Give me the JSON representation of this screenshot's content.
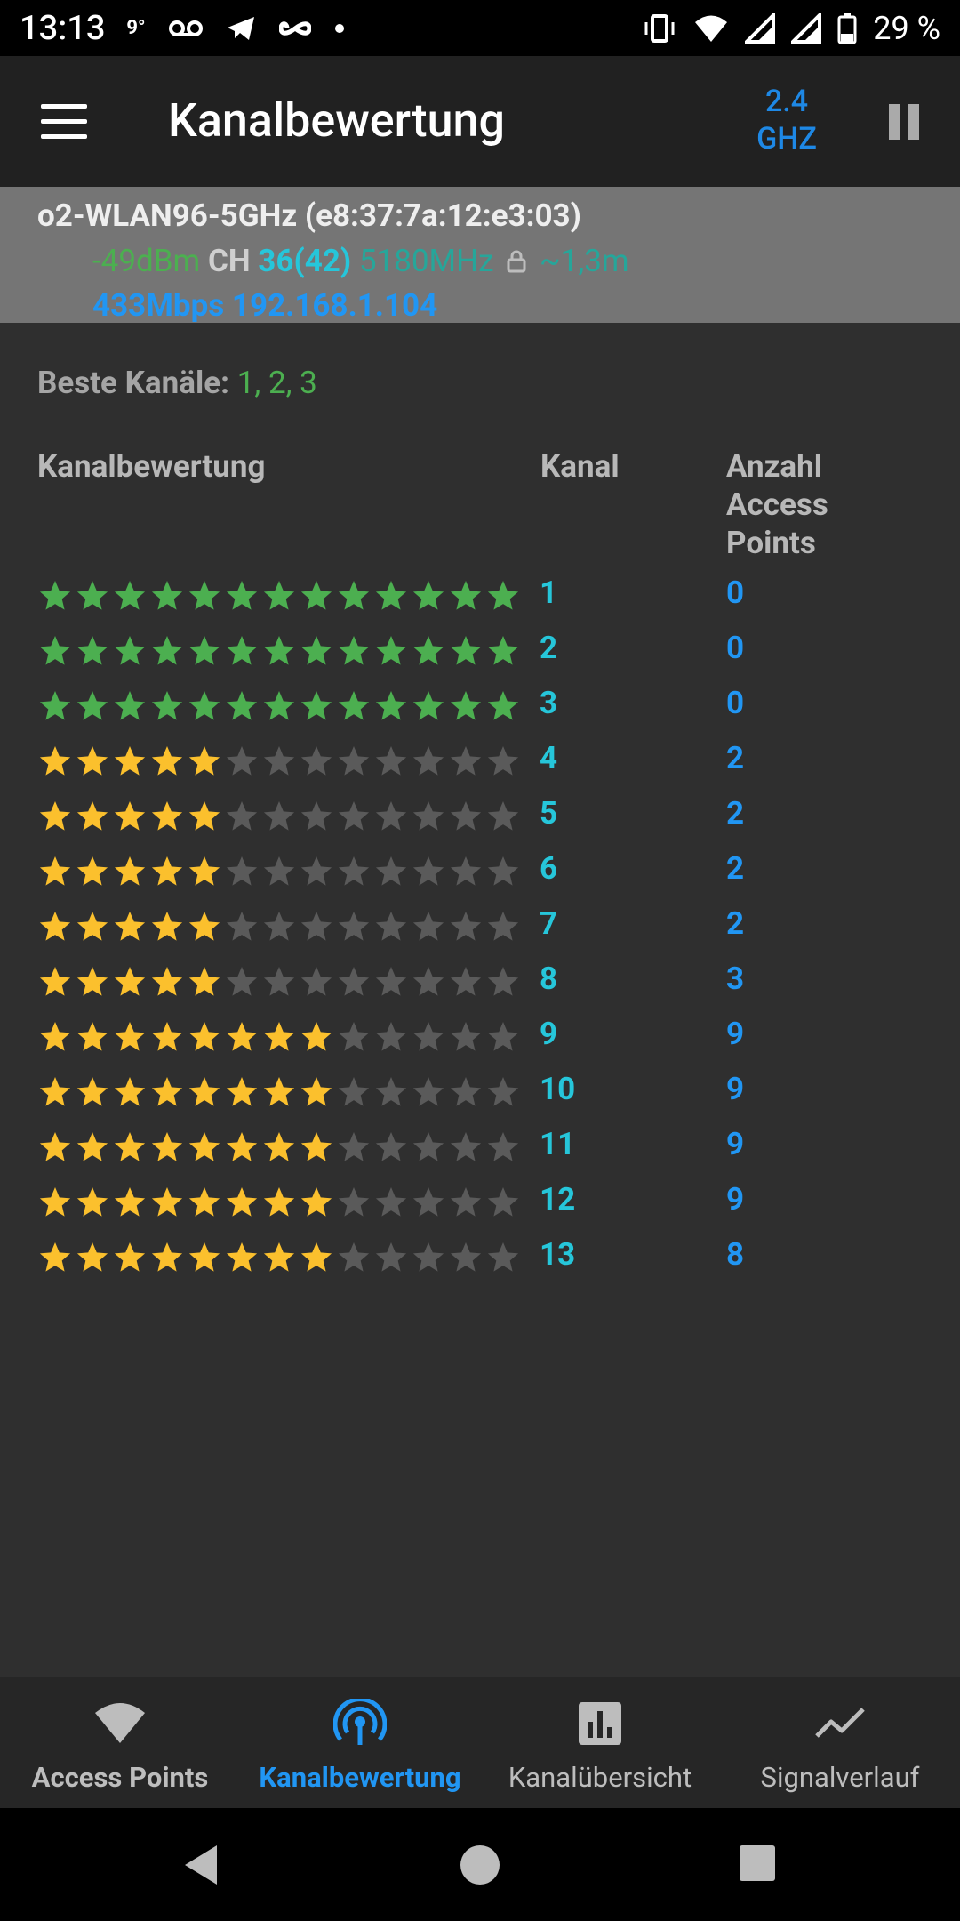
{
  "status_bar": {
    "time": "13:13",
    "temperature": "9°",
    "battery": "29 %",
    "icons": [
      "voicemail-icon",
      "telegram-icon",
      "infinity-icon",
      "dot-icon",
      "vibrate-icon",
      "wifi-icon",
      "signal-icon",
      "signal-icon",
      "battery-icon"
    ]
  },
  "app_bar": {
    "title": "Kanalbewertung",
    "band_line1": "2.4",
    "band_line2": "GHZ"
  },
  "connection": {
    "ssid_line": "o2-WLAN96-5GHz (e8:37:7a:12:e3:03)",
    "signal": "-49dBm",
    "ch_label": "CH",
    "channel": "36(42)",
    "frequency": "5180MHz",
    "distance": "~1,3m",
    "link": "433Mbps 192.168.1.104"
  },
  "best_channels": {
    "label": "Beste Kanäle:",
    "value": "1, 2, 3"
  },
  "table": {
    "header_rating": "Kanalbewertung",
    "header_channel": "Kanal",
    "header_count_1": "Anzahl",
    "header_count_2": "Access",
    "header_count_3": "Points",
    "total_stars": 13,
    "rows": [
      {
        "channel": "1",
        "ap_count": "0",
        "rating": 13,
        "color": "#4caf50"
      },
      {
        "channel": "2",
        "ap_count": "0",
        "rating": 13,
        "color": "#4caf50"
      },
      {
        "channel": "3",
        "ap_count": "0",
        "rating": 13,
        "color": "#4caf50"
      },
      {
        "channel": "4",
        "ap_count": "2",
        "rating": 5,
        "color": "#fbc02d"
      },
      {
        "channel": "5",
        "ap_count": "2",
        "rating": 5,
        "color": "#fbc02d"
      },
      {
        "channel": "6",
        "ap_count": "2",
        "rating": 5,
        "color": "#fbc02d"
      },
      {
        "channel": "7",
        "ap_count": "2",
        "rating": 5,
        "color": "#fbc02d"
      },
      {
        "channel": "8",
        "ap_count": "3",
        "rating": 5,
        "color": "#fbc02d"
      },
      {
        "channel": "9",
        "ap_count": "9",
        "rating": 8,
        "color": "#fbc02d"
      },
      {
        "channel": "10",
        "ap_count": "9",
        "rating": 8,
        "color": "#fbc02d"
      },
      {
        "channel": "11",
        "ap_count": "9",
        "rating": 8,
        "color": "#fbc02d"
      },
      {
        "channel": "12",
        "ap_count": "9",
        "rating": 8,
        "color": "#fbc02d"
      },
      {
        "channel": "13",
        "ap_count": "8",
        "rating": 8,
        "color": "#fbc02d"
      }
    ]
  },
  "bottom_nav": {
    "items": [
      {
        "label": "Access Points",
        "icon": "wifi-icon"
      },
      {
        "label": "Kanalbewertung",
        "icon": "radar-icon"
      },
      {
        "label": "Kanalübersicht",
        "icon": "bar-chart-icon"
      },
      {
        "label": "Signalverlauf",
        "icon": "trend-line-icon"
      }
    ],
    "active_index": 1
  },
  "colors": {
    "accent": "#2196f3",
    "green": "#4caf50",
    "teal": "#26c6da",
    "star_yellow": "#fbc02d",
    "star_empty": "#5a5a5a"
  }
}
